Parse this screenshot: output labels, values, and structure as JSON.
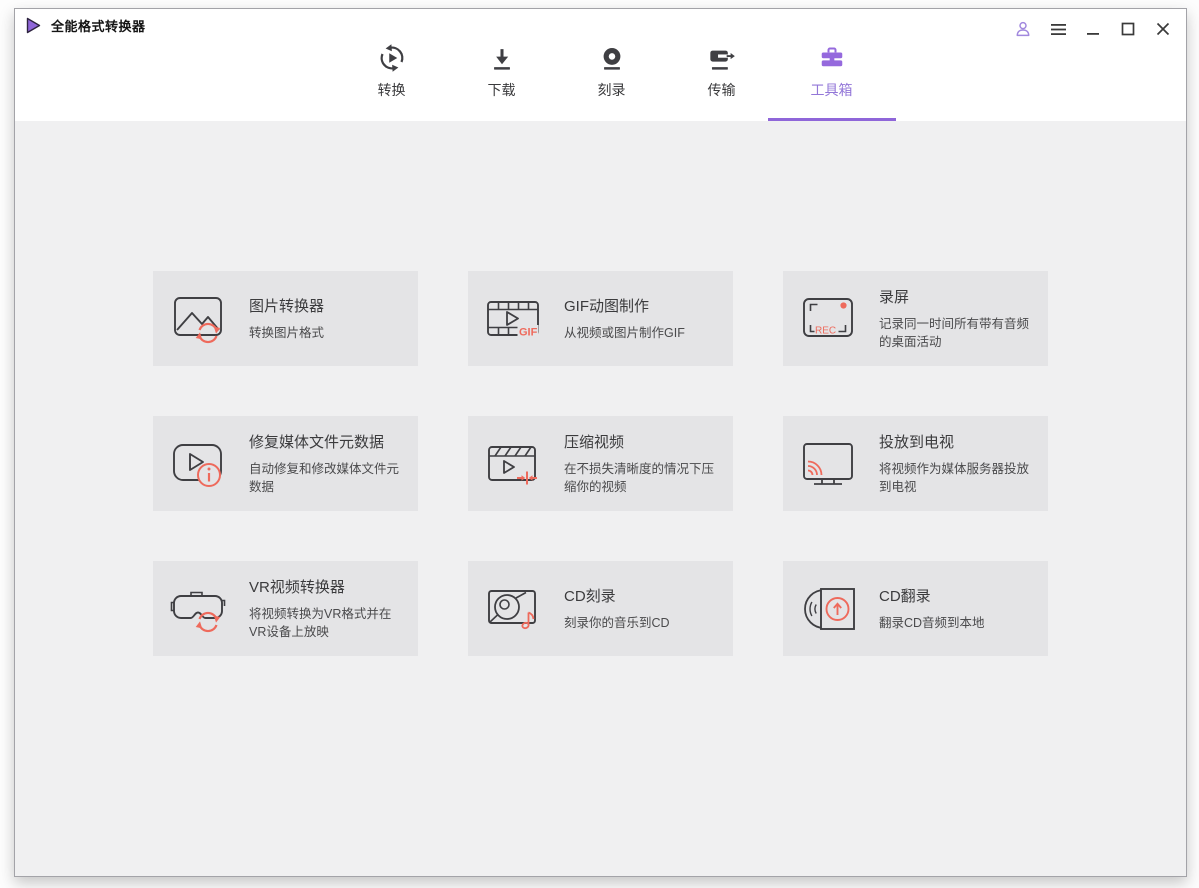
{
  "colors": {
    "accent": "#8f66d9",
    "accent_icon": "#9569dd",
    "coral": "#ee6a5c",
    "icon_dark": "#3f3f43",
    "header_bg": "#ffffff",
    "content_bg": "#f0f0f1",
    "card_bg": "#e4e4e6"
  },
  "titlebar": {
    "title": "全能格式转换器",
    "logo_icon": "play-triangle-logo",
    "controls": [
      "account-icon",
      "menu-icon",
      "minimize-icon",
      "maximize-icon",
      "close-icon"
    ]
  },
  "nav": {
    "active_index": 4,
    "tabs": [
      {
        "label": "转换",
        "icon": "convert-icon",
        "active": false
      },
      {
        "label": "下载",
        "icon": "download-icon",
        "active": false
      },
      {
        "label": "刻录",
        "icon": "burn-icon",
        "active": false
      },
      {
        "label": "传输",
        "icon": "transfer-icon",
        "active": false
      },
      {
        "label": "工具箱",
        "icon": "toolbox-icon",
        "active": true
      }
    ]
  },
  "toolbox": {
    "cards": [
      {
        "title": "图片转换器",
        "desc": "转换图片格式",
        "icon": "image-converter-icon"
      },
      {
        "title": "GIF动图制作",
        "desc": "从视频或图片制作GIF",
        "icon": "gif-maker-icon",
        "icon_text": "GIF"
      },
      {
        "title": "录屏",
        "desc": "记录同一时间所有带有音频的桌面活动",
        "icon": "screen-record-icon",
        "icon_text": "REC"
      },
      {
        "title": "修复媒体文件元数据",
        "desc": "自动修复和修改媒体文件元数据",
        "icon": "fix-metadata-icon"
      },
      {
        "title": "压缩视频",
        "desc": "在不损失清晰度的情况下压缩你的视频",
        "icon": "compress-video-icon"
      },
      {
        "title": "投放到电视",
        "desc": "将视频作为媒体服务器投放到电视",
        "icon": "cast-to-tv-icon"
      },
      {
        "title": "VR视频转换器",
        "desc": "将视频转换为VR格式并在VR设备上放映",
        "icon": "vr-converter-icon"
      },
      {
        "title": "CD刻录",
        "desc": "刻录你的音乐到CD",
        "icon": "cd-burn-icon"
      },
      {
        "title": "CD翻录",
        "desc": "翻录CD音频到本地",
        "icon": "cd-rip-icon"
      }
    ]
  }
}
